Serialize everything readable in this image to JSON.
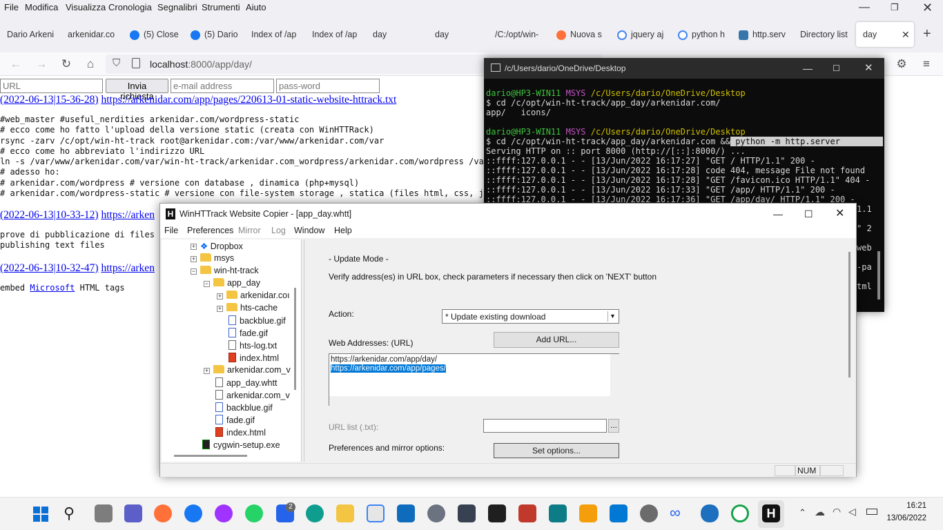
{
  "firefox": {
    "menu": [
      "File",
      "Modifica",
      "Visualizza",
      "Cronologia",
      "Segnalibri",
      "Strumenti",
      "Aiuto"
    ],
    "tabs": [
      {
        "label": "Dario Arkeni",
        "color": ""
      },
      {
        "label": "arkenidar.co",
        "color": ""
      },
      {
        "label": "(5) Close",
        "color": "#1877f2"
      },
      {
        "label": "(5) Dario",
        "color": "#1877f2"
      },
      {
        "label": "Index of /ap",
        "color": ""
      },
      {
        "label": "Index of /ap",
        "color": ""
      },
      {
        "label": "day",
        "color": ""
      },
      {
        "label": "day",
        "color": ""
      },
      {
        "label": "/C:/opt/win-",
        "color": ""
      },
      {
        "label": "Nuova s",
        "color": "#ff7139"
      },
      {
        "label": "jquery aj",
        "color": "#4285f4"
      },
      {
        "label": "python h",
        "color": "#4285f4"
      },
      {
        "label": "http.serv",
        "color": "#3776ab"
      },
      {
        "label": "Directory list",
        "color": ""
      },
      {
        "label": "day",
        "color": ""
      }
    ],
    "url_prefix": "localhost",
    "url_rest": ":8000/app/day/"
  },
  "page": {
    "url_placeholder": "URL",
    "send_button": "Invia richiesta",
    "email_placeholder": "e-mail address",
    "password_placeholder": "pass-word",
    "posts": [
      {
        "date": "(2022-06-13|15-36-28)",
        "link": "https://arkenidar.com/app/pages/220613-01-static-website-httrack.txt"
      },
      {
        "date": "(2022-06-13|10-33-12)",
        "link": "https://arken"
      },
      {
        "date": "(2022-06-13|10-32-47)",
        "link": "https://arken"
      }
    ],
    "text_block_1": [
      "#web_master #useful_nerdities arkenidar.com/wordpress-static",
      "# ecco come ho fatto l'upload della versione static (creata con WinHTTRack)",
      "rsync -zarv /c/opt/win-ht-track root@arkenidar.com:/var/www/arkenidar.com/var",
      "# ecco come ho abbreviato l'indirizzo URL",
      "ln -s /var/www/arkenidar.com/var/win-ht-track/arkenidar.com_wordpress/arkenidar.com/wordpress /var/w",
      "# adesso ho:",
      "# arkenidar.com/wordpress # versione con database , dinamica (php+mysql)",
      "# arkenidar.com/wordpress-static # versione con file-system storage , statica (files html, css, js)"
    ],
    "text_block_2": [
      "prove di pubblicazione di files .",
      "publishing text files"
    ],
    "embed_pre": "embed ",
    "embed_link": "Microsoft",
    "embed_post": " HTML tags"
  },
  "terminal": {
    "title": "/c/Users/dario/OneDrive/Desktop",
    "prompt_user": "dario@HP3-WIN11",
    "prompt_env": "MSYS",
    "prompt_path": "/c/Users/dario/OneDrive/Desktop",
    "cmd1": "$ cd /c/opt/win-ht-track/app_day/arkenidar.com/",
    "out1": "app/   icons/",
    "cmd2": "$ cd /c/opt/win-ht-track/app_day/arkenidar.com &&",
    "cmd2_hl": " python -m http.server",
    "log": [
      "Serving HTTP on :: port 8000 (http://[::]:8000/) ...",
      "::ffff:127.0.0.1 - - [13/Jun/2022 16:17:27] \"GET / HTTP/1.1\" 200 -",
      "::ffff:127.0.0.1 - - [13/Jun/2022 16:17:28] code 404, message File not found",
      "::ffff:127.0.0.1 - - [13/Jun/2022 16:17:28] \"GET /favicon.ico HTTP/1.1\" 404 -",
      "::ffff:127.0.0.1 - - [13/Jun/2022 16:17:33] \"GET /app/ HTTP/1.1\" 200 -",
      "::ffff:127.0.0.1 - - [13/Jun/2022 16:17:36] \"GET /app/day/ HTTP/1.1\" 200 -"
    ],
    "peek": [
      "1.1",
      "\" 2",
      "web",
      "-pa",
      "tml"
    ]
  },
  "httrack": {
    "title": "WinHTTrack Website Copier - [app_day.whtt]",
    "menu": [
      "File",
      "Preferences",
      "Mirror",
      "Log",
      "Window",
      "Help"
    ],
    "tree": [
      {
        "label": "Dropbox",
        "type": "dropbox"
      },
      {
        "label": "msys",
        "type": "folder"
      },
      {
        "label": "win-ht-track",
        "type": "folder"
      },
      {
        "label": "app_day",
        "type": "folder"
      },
      {
        "label": "arkenidar.coı",
        "type": "folder"
      },
      {
        "label": "hts-cache",
        "type": "folder"
      },
      {
        "label": "backblue.gif",
        "type": "file"
      },
      {
        "label": "fade.gif",
        "type": "file"
      },
      {
        "label": "hts-log.txt",
        "type": "file"
      },
      {
        "label": "index.html",
        "type": "html"
      },
      {
        "label": "arkenidar.com_v",
        "type": "folder"
      },
      {
        "label": "app_day.whtt",
        "type": "file"
      },
      {
        "label": "arkenidar.com_v",
        "type": "file"
      },
      {
        "label": "backblue.gif",
        "type": "file"
      },
      {
        "label": "fade.gif",
        "type": "file"
      },
      {
        "label": "index.html",
        "type": "html"
      },
      {
        "label": "cygwin-setup.exe",
        "type": "exe"
      }
    ],
    "mode_title": "- Update Mode -",
    "mode_desc": "Verify address(es) in URL box, check parameters if necessary then click on 'NEXT' button",
    "action_label": "Action:",
    "action_value": "* Update existing download",
    "web_addresses_label": "Web Addresses: (URL)",
    "add_url": "Add URL...",
    "url_line1": "https://arkenidar.com/app/day/",
    "url_line2": "https://arkenidar.com/app/pages/",
    "url_list_label": "URL list (.txt):",
    "browse": "...",
    "prefs_label": "Preferences and mirror options:",
    "set_options": "Set options...",
    "status_num": "NUM"
  },
  "taskbar": {
    "time": "16:21",
    "date": "13/06/2022",
    "badge": "2"
  }
}
